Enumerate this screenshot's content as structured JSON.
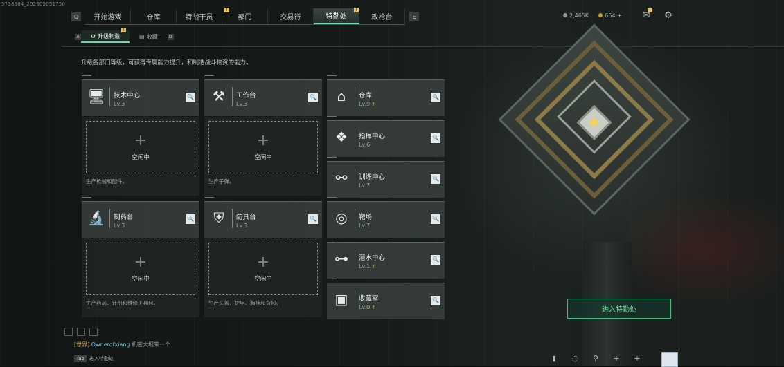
{
  "watermark": "5738984_202605051750",
  "nav": {
    "left_key": "Q",
    "right_key": "E",
    "tabs": [
      {
        "label": "开始游戏",
        "active": false,
        "badge": ""
      },
      {
        "label": "仓库",
        "active": false,
        "badge": ""
      },
      {
        "label": "特战干员",
        "active": false,
        "badge": ""
      },
      {
        "label": "部门",
        "active": false,
        "badge": "!"
      },
      {
        "label": "交易行",
        "active": false,
        "badge": ""
      },
      {
        "label": "特勤处",
        "active": true,
        "badge": "!"
      },
      {
        "label": "改枪台",
        "active": false,
        "badge": ""
      }
    ]
  },
  "currency": {
    "first": "2,465K",
    "second": "664"
  },
  "topicons": {
    "mail_badge": "!"
  },
  "subnav": {
    "left_key": "A",
    "right_key": "D",
    "tabs": [
      {
        "label": "升级制造",
        "icon": "upgrade-icon",
        "badge": "!"
      },
      {
        "label": "收藏",
        "icon": "collection-icon",
        "badge": ""
      }
    ]
  },
  "description": "升级各部门等级，可获得专属能力提升，和制造战斗物资的能力。",
  "left_cards": [
    {
      "name": "技术中心",
      "level": "Lv.3",
      "icon": "computer-icon"
    },
    {
      "name": "工作台",
      "level": "Lv.3",
      "icon": "tools-icon"
    },
    {
      "name": "制药台",
      "level": "Lv.3",
      "icon": "microscope-icon"
    },
    {
      "name": "防具台",
      "level": "Lv.3",
      "icon": "armor-icon"
    }
  ],
  "slots": [
    {
      "status": "空闲中",
      "desc": "生产枪械和配件。"
    },
    {
      "status": "空闲中",
      "desc": "生产子弹。"
    },
    {
      "status": "空闲中",
      "desc": "生产药品、针剂和维修工具包。"
    },
    {
      "status": "空闲中",
      "desc": "生产头盔、护甲、胸挂和背包。"
    }
  ],
  "right_cards": [
    {
      "name": "仓库",
      "level": "Lv.9",
      "up": true,
      "icon": "warehouse-icon"
    },
    {
      "name": "指挥中心",
      "level": "Lv.6",
      "up": false,
      "icon": "command-icon"
    },
    {
      "name": "训练中心",
      "level": "Lv.7",
      "up": false,
      "icon": "dumbbell-icon"
    },
    {
      "name": "靶场",
      "level": "Lv.7",
      "up": false,
      "icon": "target-icon"
    },
    {
      "name": "潜水中心",
      "level": "Lv.1",
      "up": true,
      "icon": "diving-icon"
    },
    {
      "name": "收藏室",
      "level": "Lv.0",
      "up": true,
      "icon": "collection-room-icon"
    }
  ],
  "enter_button": "进入特勤处",
  "chat": {
    "channel": "[世界]",
    "user": "Ownerofxiang",
    "message": "机密大坝来一个",
    "key": "Tab",
    "action": "进入特勤处"
  },
  "colors": {
    "accent": "#5ee0a8",
    "badge": "#e8c35a",
    "enter": "#2fc687"
  }
}
